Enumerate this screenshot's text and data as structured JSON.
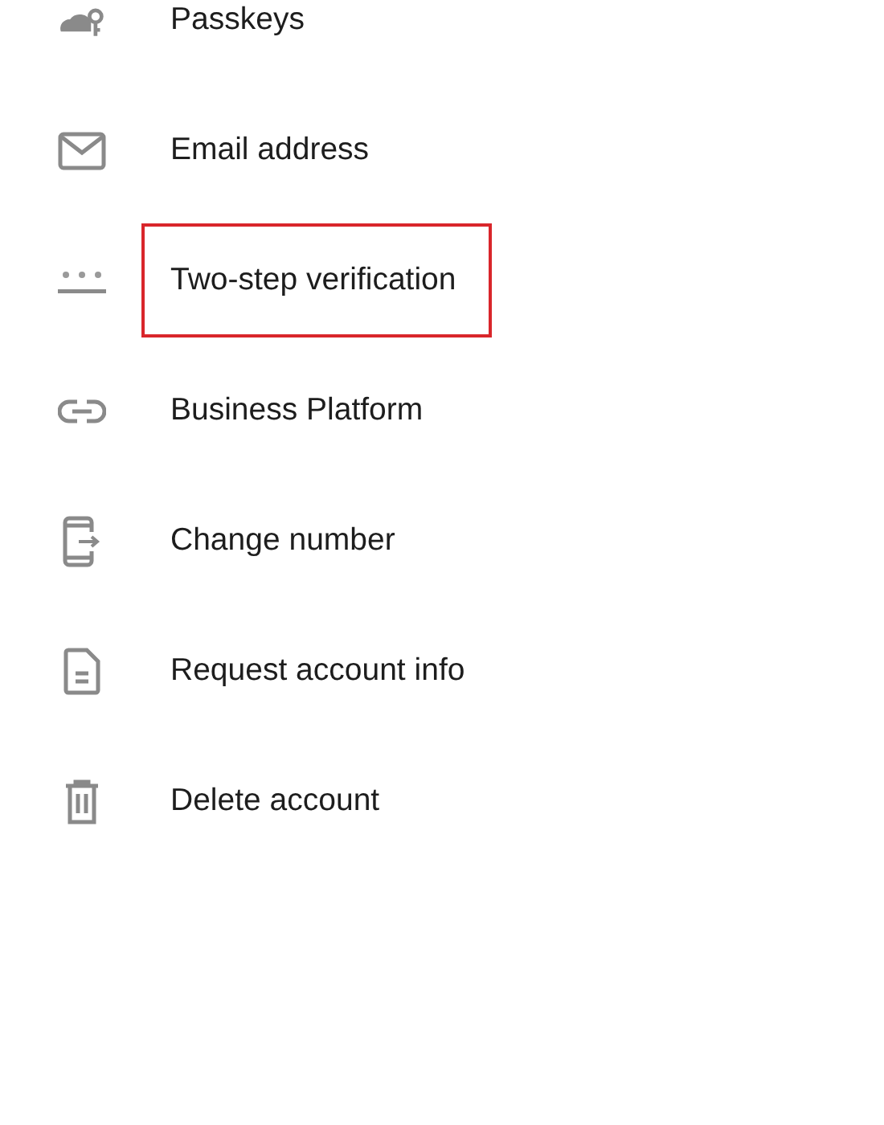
{
  "items": [
    {
      "label": "Passkeys",
      "highlighted": false
    },
    {
      "label": "Email address",
      "highlighted": false
    },
    {
      "label": "Two-step verification",
      "highlighted": true
    },
    {
      "label": "Business Platform",
      "highlighted": false
    },
    {
      "label": "Change number",
      "highlighted": false
    },
    {
      "label": "Request account info",
      "highlighted": false
    },
    {
      "label": "Delete account",
      "highlighted": false
    }
  ]
}
